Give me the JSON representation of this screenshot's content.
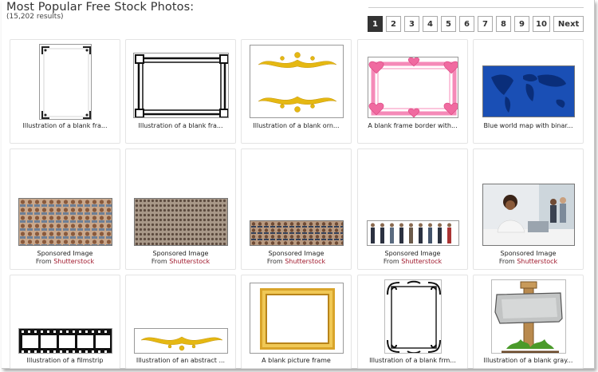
{
  "header": {
    "title": "Most Popular Free Stock Photos:",
    "result_count": "(15,202 results)"
  },
  "pagination": {
    "pages": [
      "1",
      "2",
      "3",
      "4",
      "5",
      "6",
      "7",
      "8",
      "9",
      "10"
    ],
    "current": "1",
    "next_label": "Next"
  },
  "cards": [
    {
      "caption": "Illustration of a blank fra..."
    },
    {
      "caption": "Illustration of a blank fra..."
    },
    {
      "caption": "Illustration of a blank orn..."
    },
    {
      "caption": "A blank frame border with..."
    },
    {
      "caption": "Blue world map with binar..."
    },
    {
      "sponsored": "Sponsored Image",
      "from": "From",
      "source": "Shutterstock"
    },
    {
      "sponsored": "Sponsored Image",
      "from": "From",
      "source": "Shutterstock"
    },
    {
      "sponsored": "Sponsored Image",
      "from": "From",
      "source": "Shutterstock"
    },
    {
      "sponsored": "Sponsored Image",
      "from": "From",
      "source": "Shutterstock"
    },
    {
      "sponsored": "Sponsored Image",
      "from": "From",
      "source": "Shutterstock"
    },
    {
      "caption": "Illustration of a filmstrip"
    },
    {
      "caption": "Illustration of an abstract ..."
    },
    {
      "caption": "A blank picture frame"
    },
    {
      "caption": "Illustration of a blank frm..."
    },
    {
      "caption": "Illustration of a blank gray..."
    }
  ],
  "colors": {
    "accent_link": "#a0182c",
    "active_page": "#333333",
    "gold": "#e0b010",
    "map_blue": "#1a4fb5",
    "heart_pink": "#f06aa0"
  }
}
